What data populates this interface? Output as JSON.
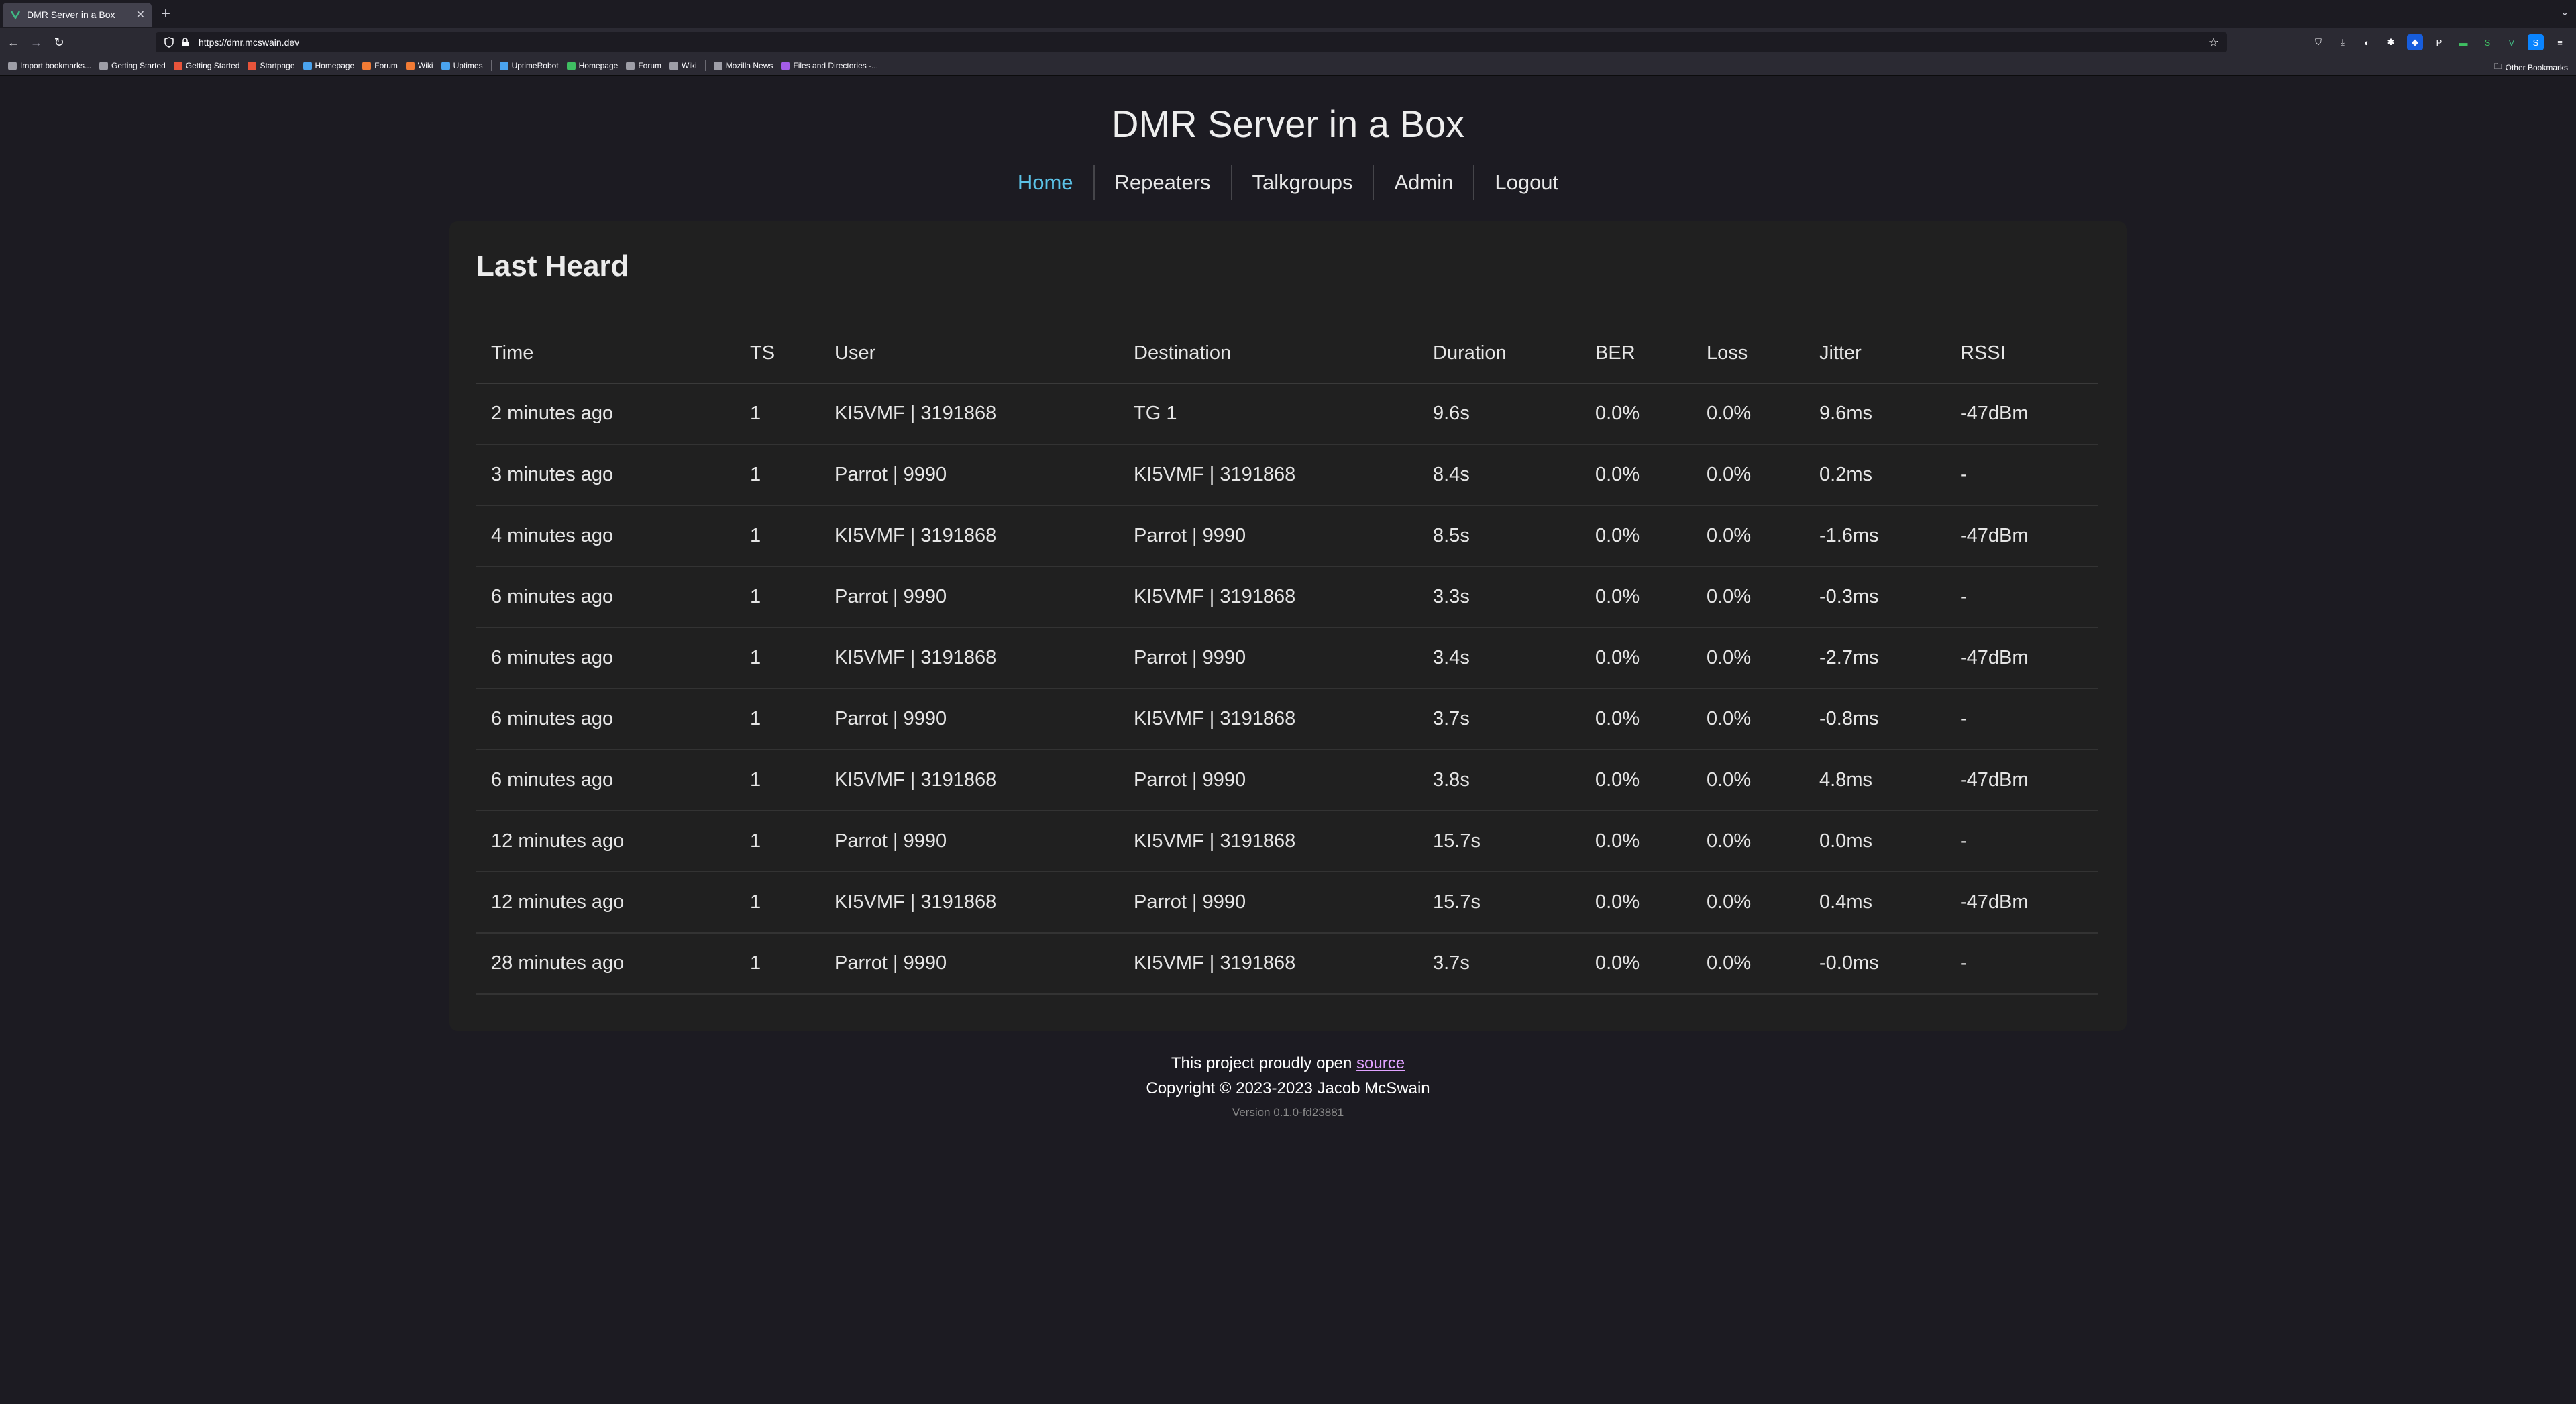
{
  "browser": {
    "tab_title": "DMR Server in a Box",
    "url": "https://dmr.mcswain.dev",
    "bookmarks": [
      {
        "label": "Import bookmarks...",
        "color": "#9e9ea7"
      },
      {
        "label": "Getting Started",
        "color": "#9e9ea7"
      },
      {
        "label": "Getting Started",
        "color": "#e8543b"
      },
      {
        "label": "Startpage",
        "color": "#e8543b"
      },
      {
        "label": "Homepage",
        "color": "#4aa3ef"
      },
      {
        "label": "Forum",
        "color": "#f27b35"
      },
      {
        "label": "Wiki",
        "color": "#f27b35"
      },
      {
        "label": "Uptimes",
        "color": "#4aa3ef"
      },
      {
        "label": "UptimeRobot",
        "color": "#4aa3ef"
      },
      {
        "label": "Homepage",
        "color": "#3fbf62"
      },
      {
        "label": "Forum",
        "color": "#9e9ea7"
      },
      {
        "label": "Wiki",
        "color": "#9e9ea7"
      },
      {
        "label": "Mozilla News",
        "color": "#9e9ea7"
      },
      {
        "label": "Files and Directories -...",
        "color": "#a35ce8"
      }
    ],
    "other_bookmarks": "Other Bookmarks"
  },
  "site": {
    "title": "DMR Server in a Box",
    "nav": [
      {
        "label": "Home",
        "active": true
      },
      {
        "label": "Repeaters",
        "active": false
      },
      {
        "label": "Talkgroups",
        "active": false
      },
      {
        "label": "Admin",
        "active": false
      },
      {
        "label": "Logout",
        "active": false
      }
    ],
    "accent_color": "#5bc2e7"
  },
  "last_heard": {
    "title": "Last Heard",
    "columns": [
      "Time",
      "TS",
      "User",
      "Destination",
      "Duration",
      "BER",
      "Loss",
      "Jitter",
      "RSSI"
    ],
    "rows": [
      [
        "2 minutes ago",
        "1",
        "KI5VMF | 3191868",
        "TG 1",
        "9.6s",
        "0.0%",
        "0.0%",
        "9.6ms",
        "-47dBm"
      ],
      [
        "3 minutes ago",
        "1",
        "Parrot | 9990",
        "KI5VMF | 3191868",
        "8.4s",
        "0.0%",
        "0.0%",
        "0.2ms",
        "-"
      ],
      [
        "4 minutes ago",
        "1",
        "KI5VMF | 3191868",
        "Parrot | 9990",
        "8.5s",
        "0.0%",
        "0.0%",
        "-1.6ms",
        "-47dBm"
      ],
      [
        "6 minutes ago",
        "1",
        "Parrot | 9990",
        "KI5VMF | 3191868",
        "3.3s",
        "0.0%",
        "0.0%",
        "-0.3ms",
        "-"
      ],
      [
        "6 minutes ago",
        "1",
        "KI5VMF | 3191868",
        "Parrot | 9990",
        "3.4s",
        "0.0%",
        "0.0%",
        "-2.7ms",
        "-47dBm"
      ],
      [
        "6 minutes ago",
        "1",
        "Parrot | 9990",
        "KI5VMF | 3191868",
        "3.7s",
        "0.0%",
        "0.0%",
        "-0.8ms",
        "-"
      ],
      [
        "6 minutes ago",
        "1",
        "KI5VMF | 3191868",
        "Parrot | 9990",
        "3.8s",
        "0.0%",
        "0.0%",
        "4.8ms",
        "-47dBm"
      ],
      [
        "12 minutes ago",
        "1",
        "Parrot | 9990",
        "KI5VMF | 3191868",
        "15.7s",
        "0.0%",
        "0.0%",
        "0.0ms",
        "-"
      ],
      [
        "12 minutes ago",
        "1",
        "KI5VMF | 3191868",
        "Parrot | 9990",
        "15.7s",
        "0.0%",
        "0.0%",
        "0.4ms",
        "-47dBm"
      ],
      [
        "28 minutes ago",
        "1",
        "Parrot | 9990",
        "KI5VMF | 3191868",
        "3.7s",
        "0.0%",
        "0.0%",
        "-0.0ms",
        "-"
      ]
    ]
  },
  "footer": {
    "open_source_text": "This project proudly open ",
    "source_link": "source",
    "copyright": "Copyright © 2023-2023 Jacob McSwain",
    "version": "Version 0.1.0-fd23881"
  }
}
